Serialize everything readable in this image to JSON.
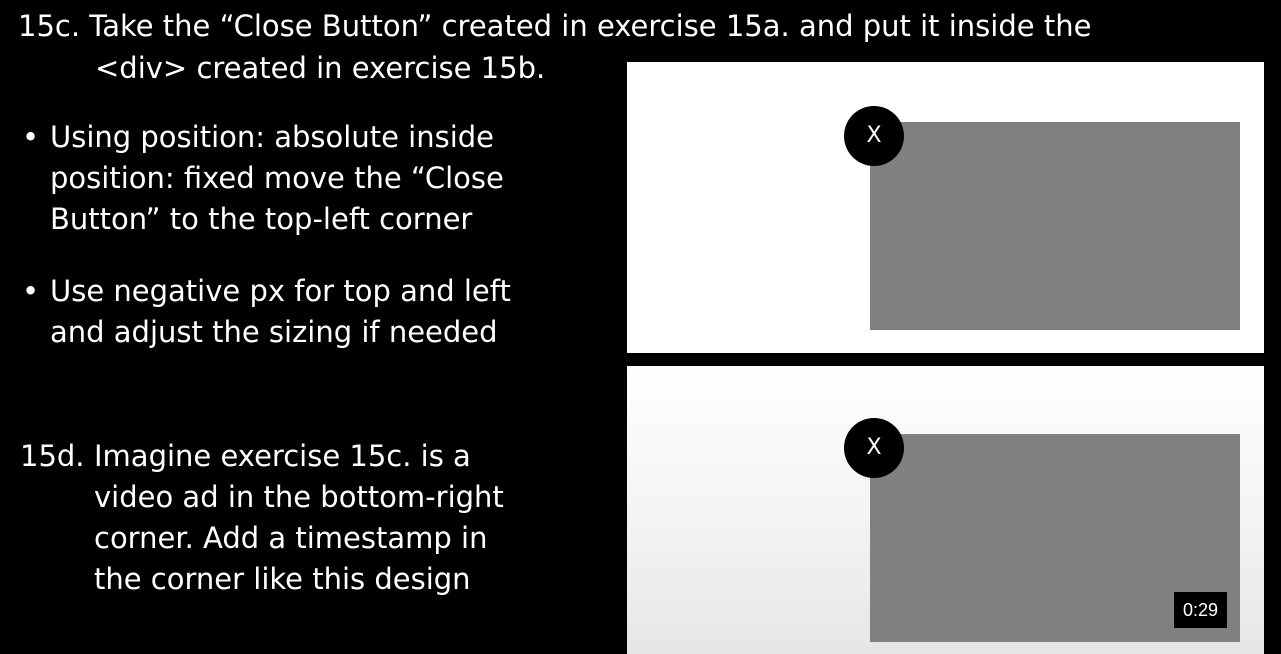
{
  "exercise_15c": {
    "title_line1": "15c. Take the “Close Button” created in exercise 15a. and put it inside the",
    "title_line2": "<div> created in exercise 15b.",
    "bullets": [
      {
        "lines": [
          "Using position: absolute inside",
          "position: fixed move the “Close",
          "Button” to the top-left corner"
        ]
      },
      {
        "lines": [
          "Use negative px for top and left",
          "and adjust the sizing if needed"
        ]
      }
    ]
  },
  "exercise_15d": {
    "number": "15d.",
    "lines": [
      "Imagine exercise 15c. is a",
      "video ad in the bottom-right",
      "corner. Add a timestamp in",
      "the corner like this design"
    ]
  },
  "bullet_symbol": "•",
  "demo_top": {
    "close_label": "X"
  },
  "demo_bottom": {
    "close_label": "X",
    "timestamp": "0:29"
  },
  "colors": {
    "background": "#000000",
    "panel": "#ffffff",
    "ad_box": "#808080",
    "close_button": "#000000"
  }
}
